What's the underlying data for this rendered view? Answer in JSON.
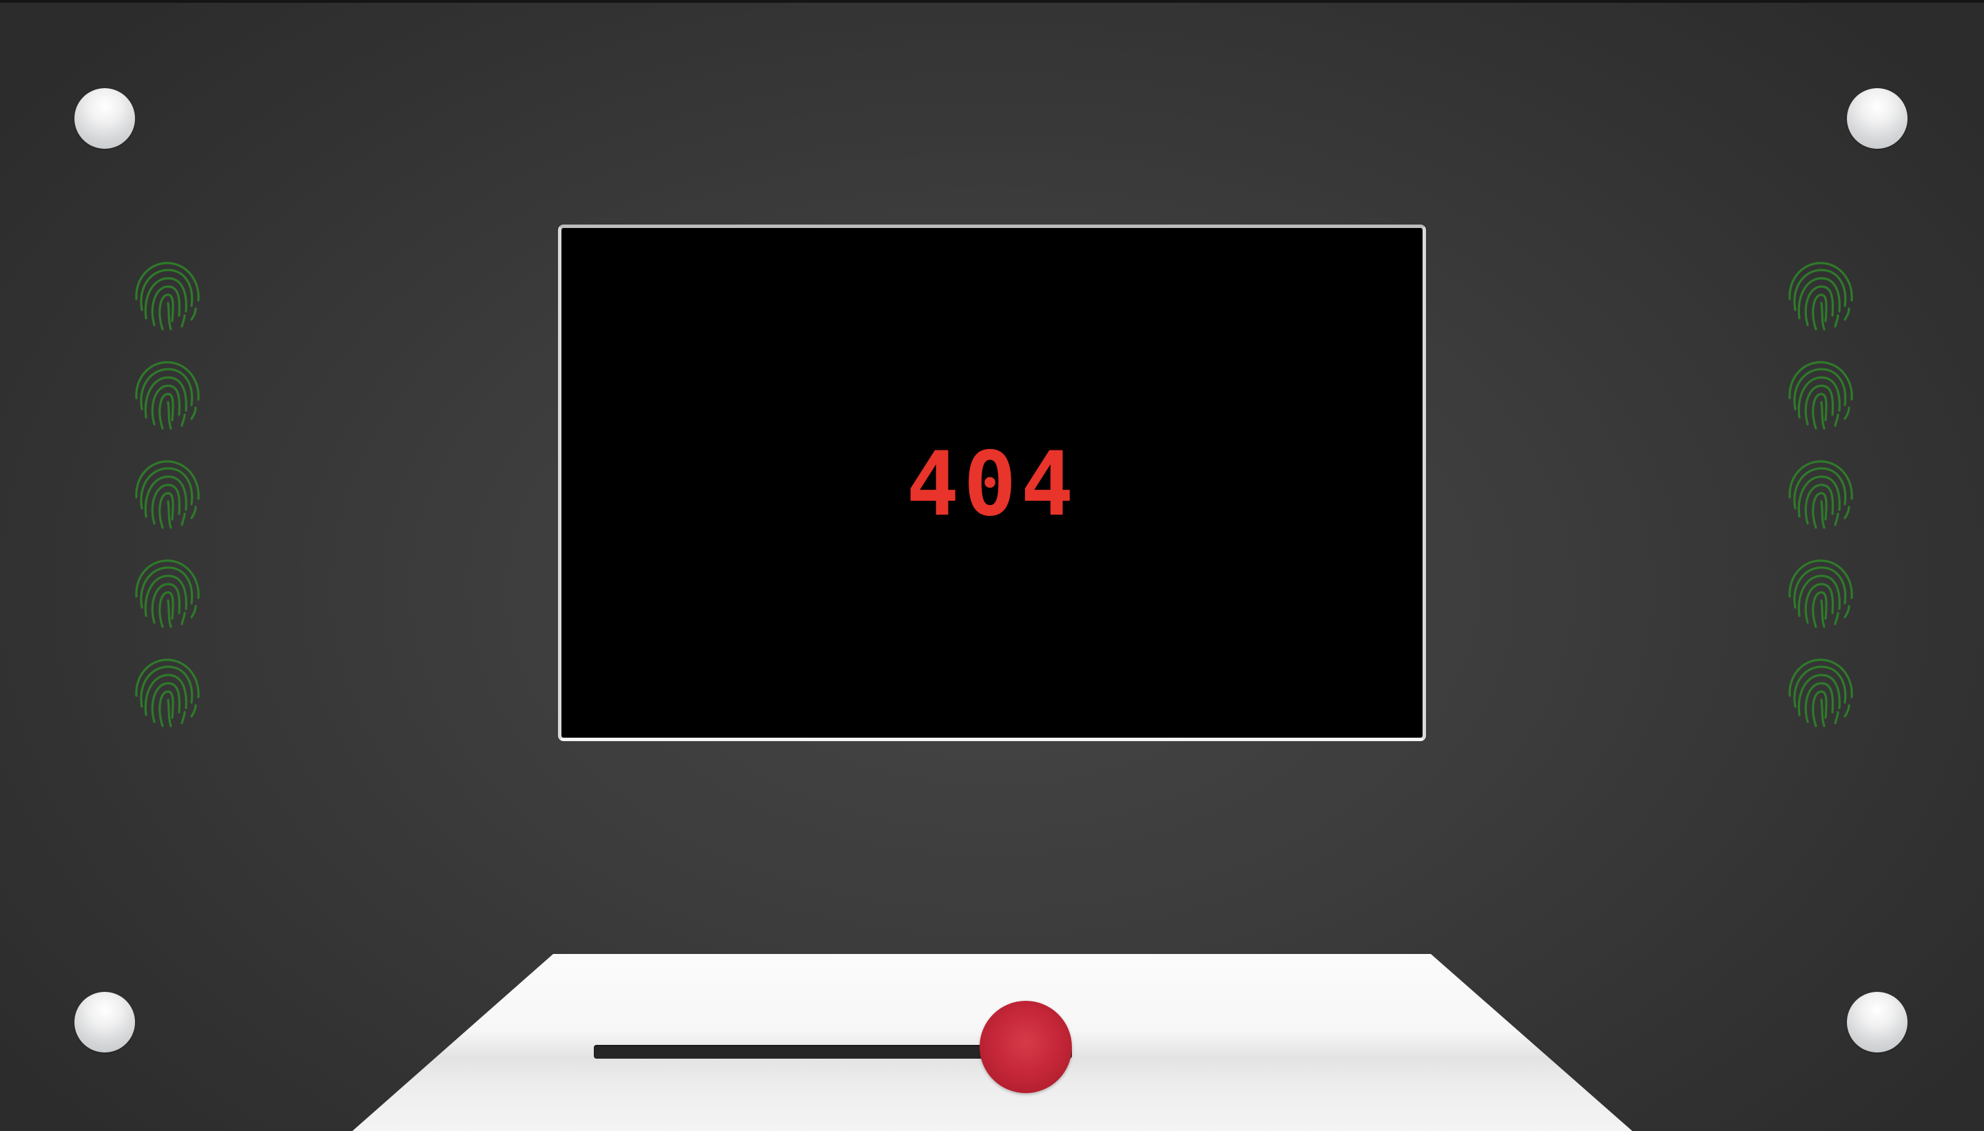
{
  "screen": {
    "error_code": "404"
  },
  "colors": {
    "panel_background": "#3c3c3c",
    "screen_background": "#000000",
    "error_text": "#e8342a",
    "fingerprint": "#2f7a2a",
    "bolt": "#e4e6e8",
    "table": "#f5f5f5",
    "slider_track": "#262626",
    "slider_knob": "#c6283a"
  },
  "icons": {
    "corner_bolt": "screw-bolt-icon",
    "fingerprint": "fingerprint-icon"
  },
  "slider": {
    "value_percent": 100
  }
}
